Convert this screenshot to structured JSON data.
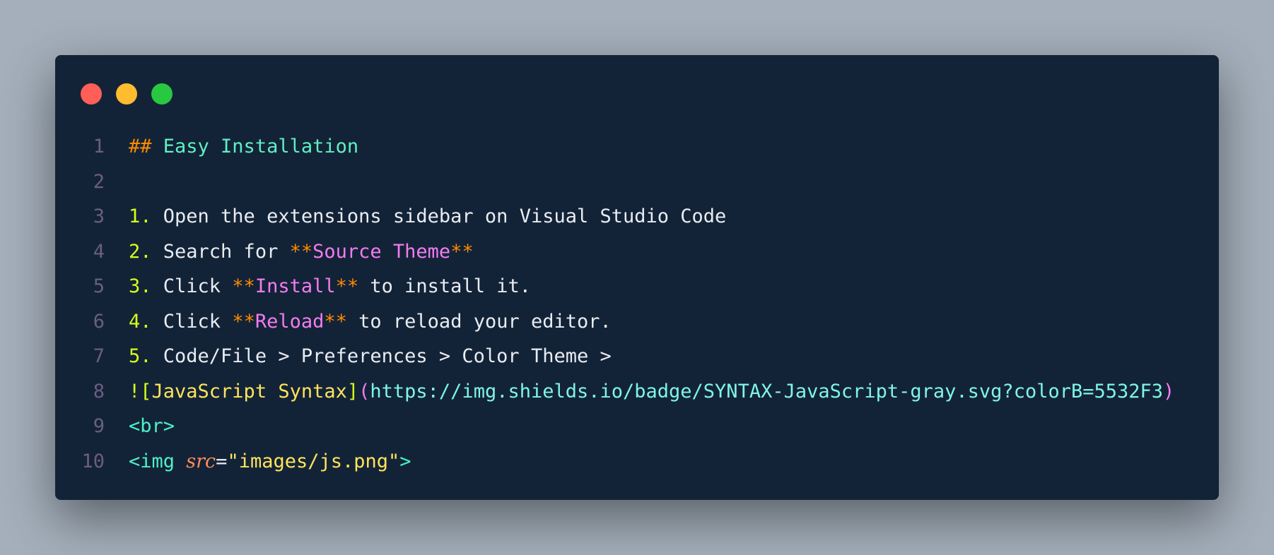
{
  "window": {
    "controls": [
      "close",
      "minimize",
      "maximize"
    ],
    "colors": {
      "close": "#ff5f57",
      "minimize": "#febc2e",
      "maximize": "#28c840",
      "background": "#132337"
    }
  },
  "lines": [
    {
      "number": "1",
      "hash": "##",
      "heading": " Easy Installation"
    },
    {
      "number": "2"
    },
    {
      "number": "3",
      "list_num": "1.",
      "text": " Open the extensions sidebar on Visual Studio Code"
    },
    {
      "number": "4",
      "list_num": "2.",
      "text": " Search for ",
      "star_open": "**",
      "bold": "Source Theme",
      "star_close": "**"
    },
    {
      "number": "5",
      "list_num": "3.",
      "text": " Click ",
      "star_open": "**",
      "bold": "Install",
      "star_close": "**",
      "tail": " to install it."
    },
    {
      "number": "6",
      "list_num": "4.",
      "text": " Click ",
      "star_open": "**",
      "bold": "Reload",
      "star_close": "**",
      "tail": " to reload your editor."
    },
    {
      "number": "7",
      "list_num": "5.",
      "text": " Code/File > Preferences > Color Theme >"
    },
    {
      "number": "8",
      "bang_bracket": "![",
      "link_text": "JavaScript Syntax",
      "bracket_close": "]",
      "paren_open": "(",
      "url": "https://img.shields.io/badge/SYNTAX-JavaScript-gray.svg?colorB=5532F3",
      "paren_close": ")"
    },
    {
      "number": "9",
      "tag": "<br>"
    },
    {
      "number": "10",
      "tag_open": "<img ",
      "attr": "src",
      "eq": "=",
      "value": "\"images/js.png\"",
      "tag_close": ">"
    }
  ]
}
